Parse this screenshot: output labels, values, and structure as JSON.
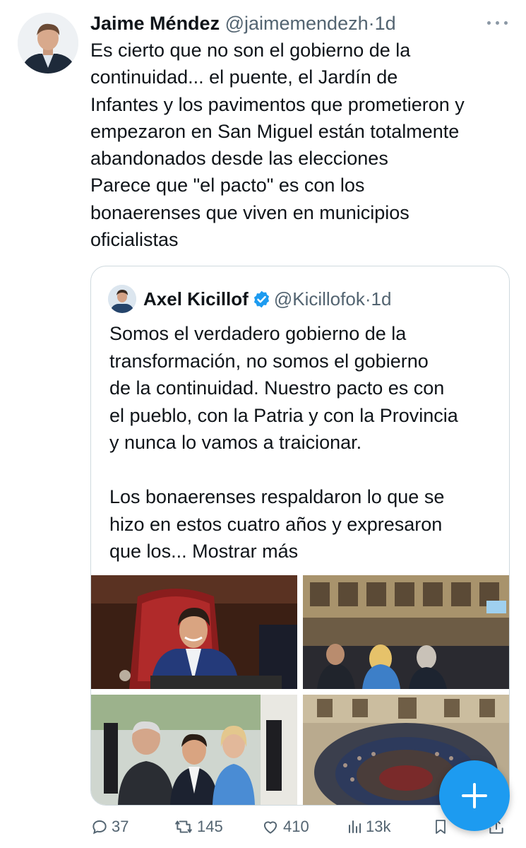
{
  "tweet": {
    "author_name": "Jaime Méndez",
    "handle": "@jaimemendezh",
    "separator": "·",
    "time": "1d",
    "text": "Es cierto que no son el gobierno de la\ncontinuidad... el puente, el Jardín de\nInfantes y los pavimentos que prometieron y\nempezaron en San Miguel están totalmente\nabandonados desde las elecciones\nParece que \"el pacto\" es con los\nbonaerenses que viven en municipios\noficialistas"
  },
  "quoted": {
    "author_name": "Axel Kicillof",
    "handle": "@Kicillofok",
    "separator": "·",
    "time": "1d",
    "verified": true,
    "text": "Somos el verdadero gobierno de la\ntransformación, no somos el gobierno\nde la continuidad. Nuestro pacto es con\nel pueblo, con la Patria y con la Provincia\ny nunca lo vamos a traicionar.\n\nLos bonaerenses respaldaron lo que se\nhizo en estos cuatro años y expresaron\nque los...",
    "show_more": "Mostrar más",
    "photos": [
      "governor-at-podium",
      "legislature-chamber-side",
      "officials-group-photo",
      "legislature-chamber-overhead"
    ]
  },
  "actions": {
    "replies": "37",
    "reposts": "145",
    "likes": "410",
    "views": "13k"
  },
  "icons": [
    "more-icon",
    "verified-icon",
    "reply-icon",
    "repost-icon",
    "like-icon",
    "views-icon",
    "bookmark-icon",
    "share-icon",
    "compose-icon"
  ],
  "colors": {
    "accent": "#1d9bf0",
    "muted": "#536471",
    "text": "#0f1419",
    "border": "#cfd9de"
  }
}
